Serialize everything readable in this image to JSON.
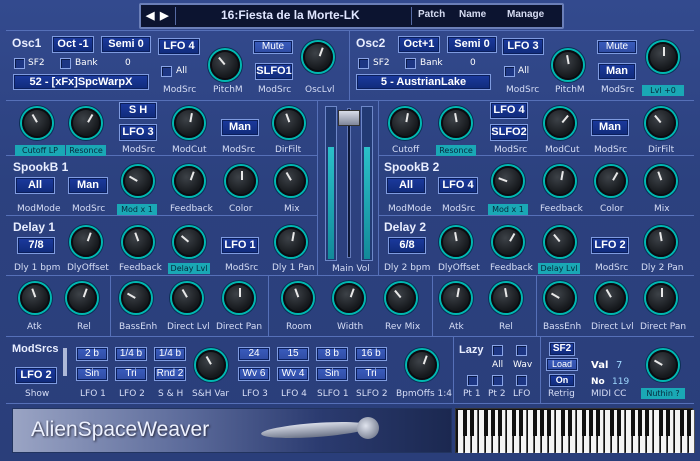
{
  "topbar": {
    "prev_icon": "left-arrow",
    "next_icon": "right-arrow",
    "prev": "◀",
    "next": "▶",
    "preset": "16:Fiesta de la Morte-LK",
    "menu": [
      "Patch",
      "Name",
      "Manage"
    ]
  },
  "osc1": {
    "title": "Osc1",
    "oct": "Oct -1",
    "semi": "Semi 0",
    "src": "LFO 4",
    "mute": "Mute",
    "sf2": "SF2",
    "bank": "Bank",
    "bank_val": "0",
    "all": "All",
    "wave": "52 - [xFx]SpcWarpX",
    "slfo": "SLFO1",
    "labels": [
      "ModSrc",
      "PitchM",
      "ModSrc",
      "OscLvl"
    ]
  },
  "osc2": {
    "title": "Osc2",
    "oct": "Oct+1",
    "semi": "Semi 0",
    "src": "LFO 3",
    "mute": "Mute",
    "sf2": "SF2",
    "bank": "Bank",
    "bank_val": "0",
    "all": "All",
    "wave": "5 - AustrianLake",
    "man": "Man",
    "labels": [
      "ModSrc",
      "PitchM",
      "ModSrc"
    ],
    "lvl": "Lvl +0"
  },
  "filt1": {
    "cutoff": "Cutoff LP",
    "reson": "Resonce",
    "sh": "S H",
    "lfo": "LFO 3",
    "man": "Man",
    "labels": [
      "ModSrc",
      "ModCut",
      "ModSrc",
      "DirFilt"
    ]
  },
  "filt2": {
    "cutoff": "Cutoff",
    "reson": "Resonce",
    "lfo": "LFO 4",
    "slfo": "SLFO2",
    "man": "Man",
    "labels": [
      "ModSrc",
      "ModCut",
      "ModSrc",
      "DirFilt"
    ]
  },
  "spook1": {
    "title": "SpookB 1",
    "all": "All",
    "man": "Man",
    "mod": "Mod x 1",
    "labels": [
      "ModMode",
      "ModSrc",
      "Feedback",
      "Color",
      "Mix"
    ]
  },
  "spook2": {
    "title": "SpookB 2",
    "all": "All",
    "lfo": "LFO 4",
    "mod": "Mod x 1",
    "labels": [
      "ModMode",
      "ModSrc",
      "Feedback",
      "Color",
      "Mix"
    ]
  },
  "delay1": {
    "title": "Delay 1",
    "bpm": "7/8",
    "lfo": "LFO 1",
    "lvl": "Delay Lvl",
    "labels": [
      "Dly 1 bpm",
      "DlyOffset",
      "Feedback",
      "ModSrc",
      "Dly 1 Pan"
    ]
  },
  "delay2": {
    "title": "Delay 2",
    "bpm": "6/8",
    "lfo": "LFO 2",
    "lvl": "Delay Lvl",
    "labels": [
      "Dly 2 bpm",
      "DlyOffset",
      "Feedback",
      "ModSrc",
      "Dly 2 Pan"
    ]
  },
  "mainvol": "Main Vol",
  "row5": {
    "labels": [
      "Atk",
      "Rel",
      "BassEnh",
      "Direct Lvl",
      "Direct Pan",
      "Room",
      "Width",
      "Rev Mix",
      "Atk",
      "Rel",
      "BassEnh",
      "Direct Lvl",
      "Direct Pan"
    ]
  },
  "modsrcs": {
    "title": "ModSrcs",
    "lfo": "LFO 2",
    "show": "Show",
    "top": [
      "2 b",
      "1/4 b",
      "1/4 b",
      "24",
      "15",
      "8 b",
      "16 b"
    ],
    "bot": [
      "Sin",
      "Tri",
      "Rnd 2",
      "Wv 6",
      "Wv 4",
      "Sin",
      "Tri"
    ],
    "labels": [
      "LFO 1",
      "LFO 2",
      "S & H",
      "S&H Var",
      "LFO 3",
      "LFO 4",
      "SLFO 1",
      "SLFO 2",
      "BpmOffs 1:4"
    ]
  },
  "lazy": {
    "title": "Lazy",
    "all": "All",
    "wav": "Wav",
    "pt1": "Pt 1",
    "pt2": "Pt 2",
    "lfo": "LFO"
  },
  "sf2": {
    "sf2": "SF2",
    "load": "Load",
    "on": "On",
    "retrig": "Retrig"
  },
  "misc": {
    "val": "Val",
    "val_num": "7",
    "no": "No",
    "no_num": "119",
    "midicc": "MIDI CC",
    "nuthin": "Nuthin ?"
  },
  "logo": "AlienSpaceWeaver",
  "colors": {
    "bg": "#2c417f",
    "button": "#102b7a",
    "accent": "#1aa8b5"
  }
}
